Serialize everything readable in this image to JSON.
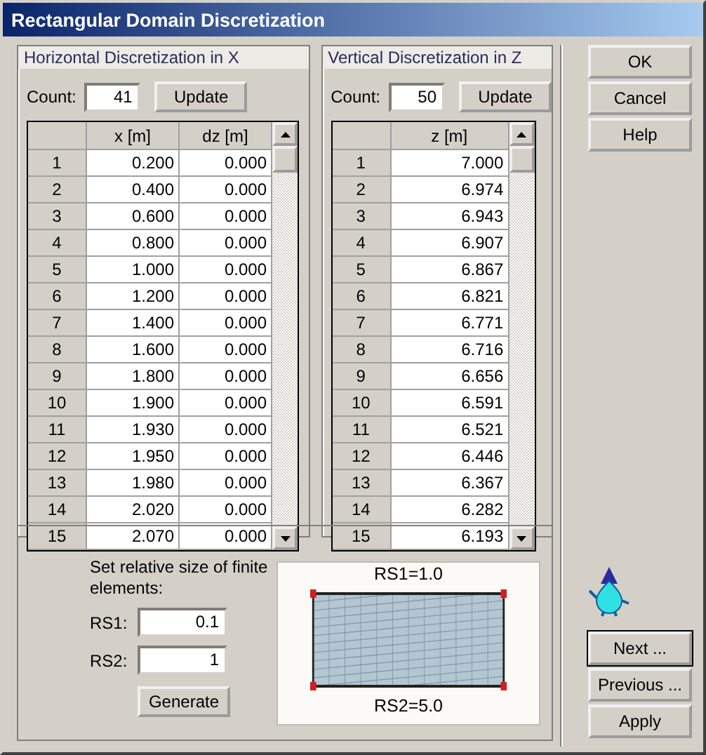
{
  "window": {
    "title": "Rectangular Domain Discretization"
  },
  "tables": [
    {
      "title": "Horizontal Discretization in X",
      "count_label": "Count:",
      "count": "41",
      "update": "Update",
      "columns": [
        "x [m]",
        "dz [m]"
      ],
      "rows": [
        [
          "1",
          "0.200",
          "0.000"
        ],
        [
          "2",
          "0.400",
          "0.000"
        ],
        [
          "3",
          "0.600",
          "0.000"
        ],
        [
          "4",
          "0.800",
          "0.000"
        ],
        [
          "5",
          "1.000",
          "0.000"
        ],
        [
          "6",
          "1.200",
          "0.000"
        ],
        [
          "7",
          "1.400",
          "0.000"
        ],
        [
          "8",
          "1.600",
          "0.000"
        ],
        [
          "9",
          "1.800",
          "0.000"
        ],
        [
          "10",
          "1.900",
          "0.000"
        ],
        [
          "11",
          "1.930",
          "0.000"
        ],
        [
          "12",
          "1.950",
          "0.000"
        ],
        [
          "13",
          "1.980",
          "0.000"
        ],
        [
          "14",
          "2.020",
          "0.000"
        ],
        [
          "15",
          "2.070",
          "0.000"
        ]
      ]
    },
    {
      "title": "Vertical Discretization in Z",
      "count_label": "Count:",
      "count": "50",
      "update": "Update",
      "columns": [
        "z [m]"
      ],
      "rows": [
        [
          "1",
          "7.000"
        ],
        [
          "2",
          "6.974"
        ],
        [
          "3",
          "6.943"
        ],
        [
          "4",
          "6.907"
        ],
        [
          "5",
          "6.867"
        ],
        [
          "6",
          "6.821"
        ],
        [
          "7",
          "6.771"
        ],
        [
          "8",
          "6.716"
        ],
        [
          "9",
          "6.656"
        ],
        [
          "10",
          "6.591"
        ],
        [
          "11",
          "6.521"
        ],
        [
          "12",
          "6.446"
        ],
        [
          "13",
          "6.367"
        ],
        [
          "14",
          "6.282"
        ],
        [
          "15",
          "6.193"
        ]
      ]
    }
  ],
  "generation": {
    "instruction": "Set relative size of finite elements:",
    "fields": [
      {
        "label": "RS1:",
        "value": "0.1"
      },
      {
        "label": "RS2:",
        "value": "1"
      }
    ],
    "button": "Generate",
    "preview": {
      "top_label": "RS1=1.0",
      "bottom_label": "RS2=5.0"
    }
  },
  "buttons": [
    {
      "label": "OK",
      "default": false
    },
    {
      "label": "Cancel",
      "default": false
    },
    {
      "label": "Help",
      "default": false
    }
  ],
  "nav_buttons": [
    {
      "label": "Next ...",
      "default": true
    },
    {
      "label": "Previous ...",
      "default": false
    },
    {
      "label": "Apply",
      "default": false
    }
  ]
}
